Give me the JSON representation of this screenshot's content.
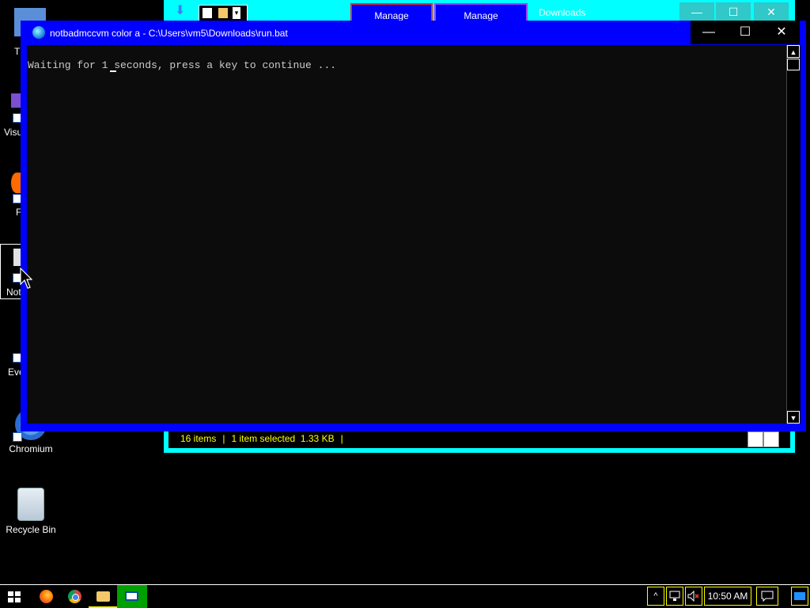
{
  "desktop": {
    "icons": [
      {
        "label": "Chromium"
      },
      {
        "label": "Recycle Bin"
      }
    ],
    "partial_labels": [
      "T",
      "Visu",
      "F",
      "Not",
      "Eve"
    ]
  },
  "explorer": {
    "tabs": [
      {
        "label": "Manage"
      },
      {
        "label": "Manage"
      }
    ],
    "title": "Downloads",
    "controls": {
      "minimize": "—",
      "maximize": "☐",
      "close": "✕"
    },
    "status": {
      "items": "16 items",
      "selected": "1 item selected",
      "size": "1.33 KB"
    }
  },
  "console": {
    "title": "notbadmccvm color a  - C:\\Users\\vm5\\Downloads\\run.bat",
    "controls": {
      "minimize": "—",
      "maximize": "☐",
      "close": "✕"
    },
    "output_line": "Waiting for 1 seconds, press a key to continue ...",
    "scroll": {
      "up": "▲",
      "down": "▼"
    }
  },
  "taskbar": {
    "clock": "10:50 AM",
    "tray_chevron": "^",
    "notification_glyph": "💬"
  }
}
